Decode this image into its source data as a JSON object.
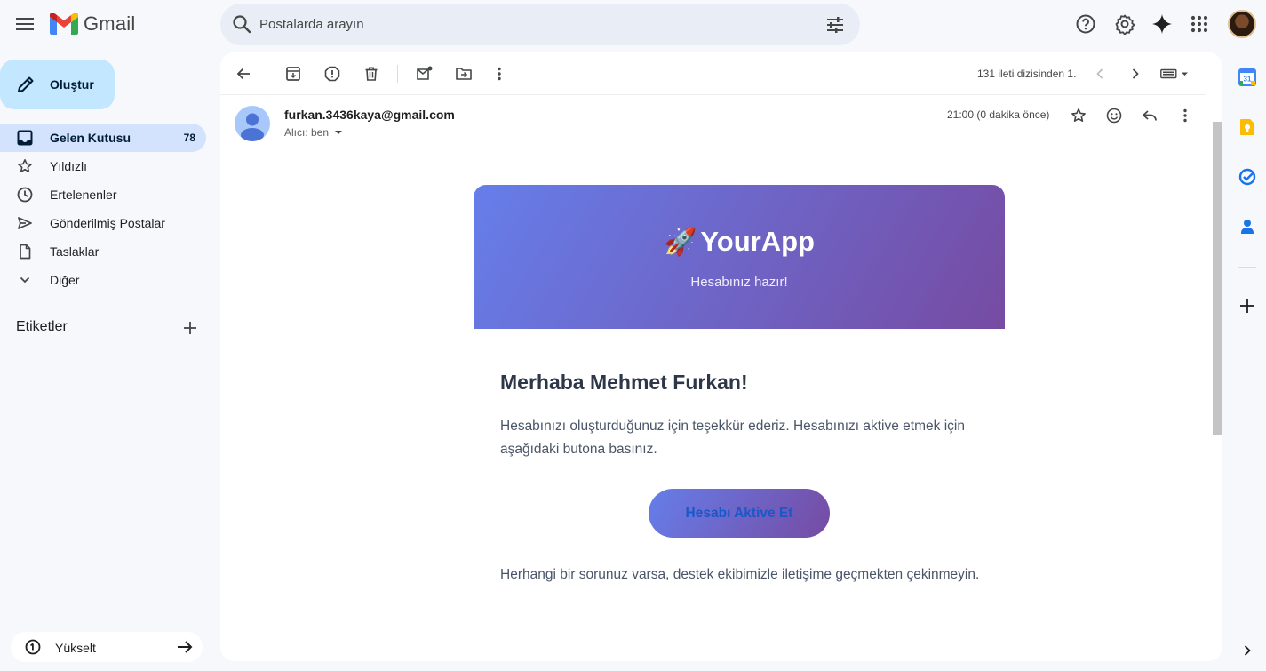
{
  "app": {
    "name": "Gmail"
  },
  "search": {
    "placeholder": "Postalarda arayın"
  },
  "sidebar": {
    "compose_label": "Oluştur",
    "items": [
      {
        "label": "Gelen Kutusu",
        "count": "78",
        "icon": "inbox-icon",
        "active": true
      },
      {
        "label": "Yıldızlı",
        "count": "",
        "icon": "star-icon",
        "active": false
      },
      {
        "label": "Ertelenenler",
        "count": "",
        "icon": "clock-icon",
        "active": false
      },
      {
        "label": "Gönderilmiş Postalar",
        "count": "",
        "icon": "send-icon",
        "active": false
      },
      {
        "label": "Taslaklar",
        "count": "",
        "icon": "draft-icon",
        "active": false
      },
      {
        "label": "Diğer",
        "count": "",
        "icon": "chevron-down-icon",
        "active": false
      }
    ],
    "labels_heading": "Etiketler",
    "upgrade_label": "Yükselt"
  },
  "toolbar": {
    "pager_text": "131 ileti dizisinden 1."
  },
  "message": {
    "sender": "furkan.3436kaya@gmail.com",
    "recipient": "Alıcı: ben",
    "time": "21:00 (0 dakika önce)"
  },
  "email": {
    "rocket": "🚀",
    "brand": "YourApp",
    "tagline": "Hesabınız hazır!",
    "greeting": "Merhaba Mehmet Furkan!",
    "paragraph_1": "Hesabınızı oluşturduğunuz için teşekkür ederiz. Hesabınızı aktive etmek için aşağıdaki butona basınız.",
    "button": "Hesabı Aktive Et",
    "paragraph_2": "Herhangi bir sorunuz varsa, destek ekibimizle iletişime geçmekten çekinmeyin."
  },
  "colors": {
    "accent_active": "#d3e3fd",
    "compose_bg": "#c2e7ff",
    "gradient_start": "#667eea",
    "gradient_end": "#764ba2",
    "button_text": "#1a57c9"
  }
}
